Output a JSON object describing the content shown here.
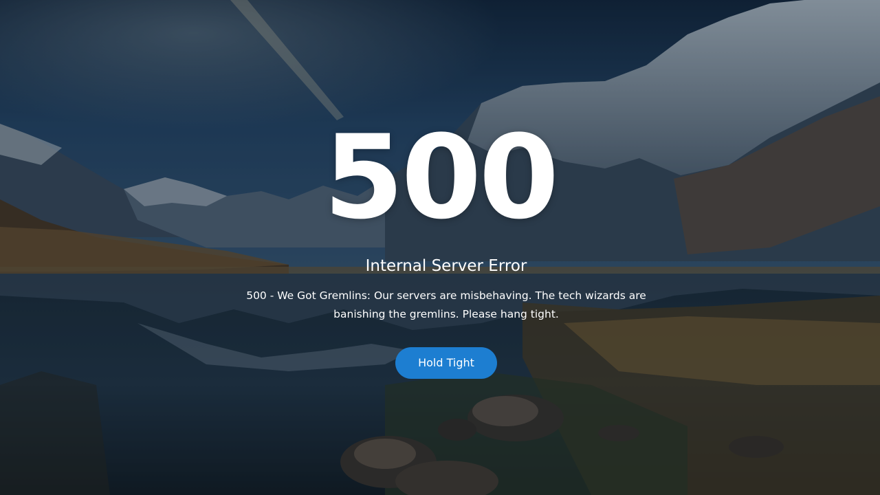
{
  "error": {
    "code": "500",
    "title": "Internal Server Error",
    "message": "500 - We Got Gremlins: Our servers are misbehaving. The tech wizards are banishing the gremlins. Please hang tight."
  },
  "actions": {
    "hold_label": "Hold Tight"
  },
  "colors": {
    "button": "#1d7ed1",
    "text": "#ffffff",
    "sky": "#1f3a56"
  }
}
